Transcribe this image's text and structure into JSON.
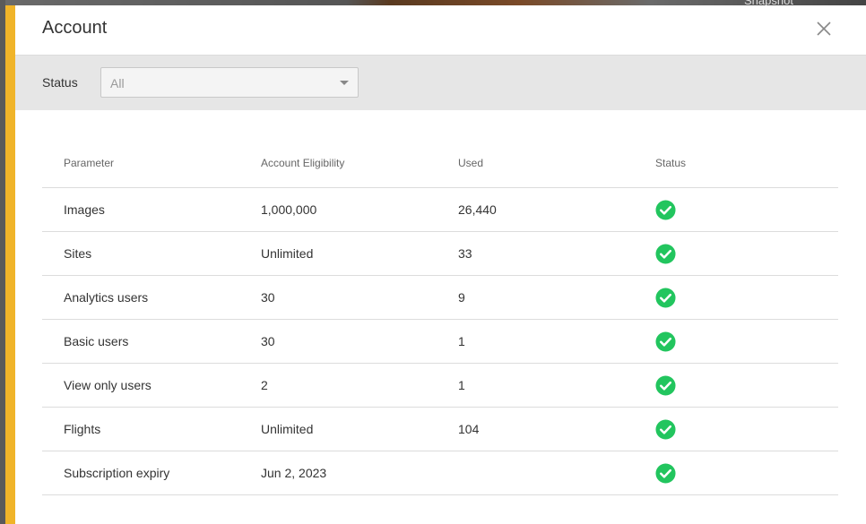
{
  "theme": {
    "accent": "#f0b429",
    "success": "#22c55e"
  },
  "background": {
    "partial_text": "Snapshot"
  },
  "modal": {
    "title": "Account",
    "close_icon": "close-icon"
  },
  "filter": {
    "label": "Status",
    "selected": "All"
  },
  "table": {
    "headers": [
      "Parameter",
      "Account Eligibility",
      "Used",
      "Status"
    ],
    "rows": [
      {
        "parameter": "Images",
        "eligibility": "1,000,000",
        "used": "26,440",
        "status": "ok"
      },
      {
        "parameter": "Sites",
        "eligibility": "Unlimited",
        "used": "33",
        "status": "ok"
      },
      {
        "parameter": "Analytics users",
        "eligibility": "30",
        "used": "9",
        "status": "ok"
      },
      {
        "parameter": "Basic users",
        "eligibility": "30",
        "used": "1",
        "status": "ok"
      },
      {
        "parameter": "View only users",
        "eligibility": "2",
        "used": "1",
        "status": "ok"
      },
      {
        "parameter": "Flights",
        "eligibility": "Unlimited",
        "used": "104",
        "status": "ok"
      },
      {
        "parameter": "Subscription expiry",
        "eligibility": "Jun 2, 2023",
        "used": "",
        "status": "ok"
      }
    ]
  }
}
